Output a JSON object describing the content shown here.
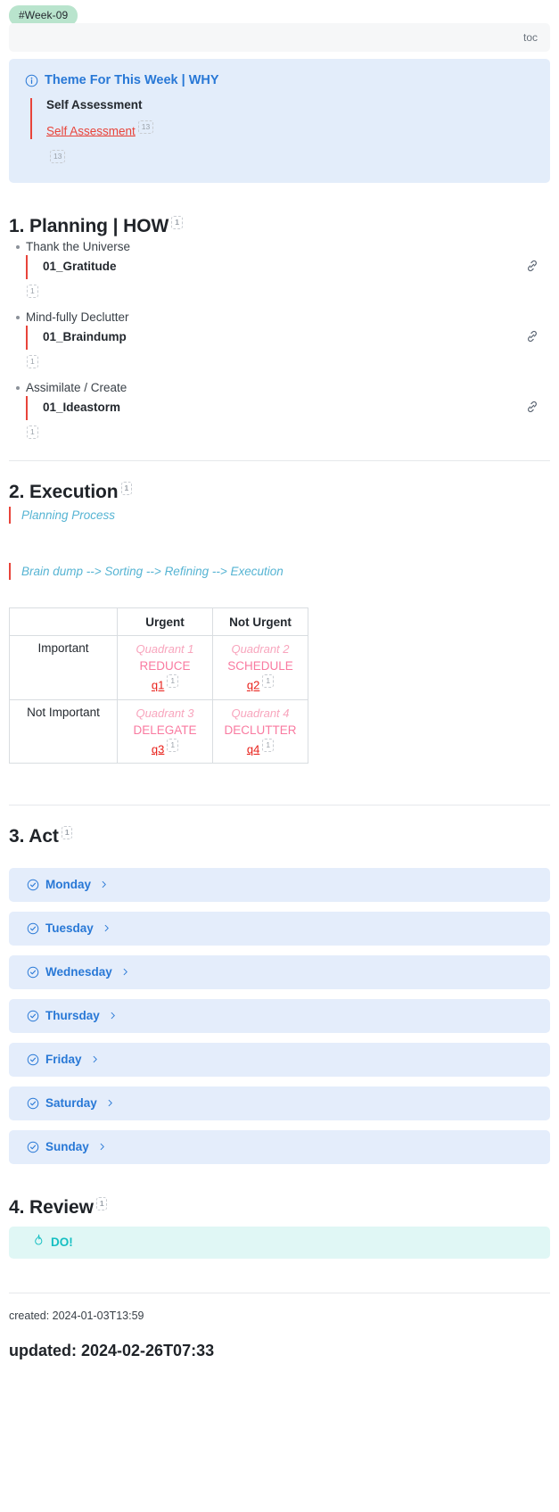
{
  "tag": "#Week-09",
  "toc": {
    "label": "toc"
  },
  "callout": {
    "icon": "info-circle-icon",
    "title": "Theme For This Week | WHY",
    "quote_heading": "Self Assessment",
    "quote_link": "Self Assessment",
    "quote_link_badge": "13",
    "tail_badge": "13"
  },
  "sections": {
    "planning": {
      "heading": "1. Planning | HOW",
      "heading_badge": "1",
      "items": [
        {
          "bullet": "Thank the Universe",
          "title": "01_Gratitude",
          "badge": "1",
          "link_icon": "link-icon"
        },
        {
          "bullet": "Mind-fully Declutter",
          "title": "01_Braindump",
          "badge": "1",
          "link_icon": "link-icon"
        },
        {
          "bullet": "Assimilate / Create",
          "title": "01_Ideastorm",
          "badge": "1",
          "link_icon": "link-icon"
        }
      ]
    },
    "execution": {
      "heading": "2. Execution",
      "heading_badge": "1",
      "quote1": "Planning Process",
      "quote2": "Brain dump --> Sorting --> Refining --> Execution"
    },
    "act": {
      "heading": "3. Act",
      "heading_badge": "1",
      "days": [
        {
          "label": "Monday",
          "icon": "circle-check-icon",
          "chevron": "chevron-right-icon"
        },
        {
          "label": "Tuesday",
          "icon": "circle-check-icon",
          "chevron": "chevron-right-icon"
        },
        {
          "label": "Wednesday",
          "icon": "circle-check-icon",
          "chevron": "chevron-right-icon"
        },
        {
          "label": "Thursday",
          "icon": "circle-check-icon",
          "chevron": "chevron-right-icon"
        },
        {
          "label": "Friday",
          "icon": "circle-check-icon",
          "chevron": "chevron-right-icon"
        },
        {
          "label": "Saturday",
          "icon": "circle-check-icon",
          "chevron": "chevron-right-icon"
        },
        {
          "label": "Sunday",
          "icon": "circle-check-icon",
          "chevron": "chevron-right-icon"
        }
      ]
    },
    "review": {
      "heading": "4. Review",
      "heading_badge": "1",
      "do": {
        "icon": "flame-icon",
        "label": "DO!"
      }
    }
  },
  "matrix": {
    "corner": "",
    "columns": [
      "Urgent",
      "Not Urgent"
    ],
    "rows": [
      {
        "label": "Important",
        "cells": [
          {
            "name": "Quadrant 1",
            "action": "REDUCE",
            "link": "q1",
            "badge": "1"
          },
          {
            "name": "Quadrant 2",
            "action": "SCHEDULE",
            "link": "q2",
            "badge": "1"
          }
        ]
      },
      {
        "label": "Not Important",
        "cells": [
          {
            "name": "Quadrant 3",
            "action": "DELEGATE",
            "link": "q3",
            "badge": "1"
          },
          {
            "name": "Quadrant 4",
            "action": "DECLUTTER",
            "link": "q4",
            "badge": "1"
          }
        ]
      }
    ]
  },
  "footer": {
    "created": "created: 2024-01-03T13:59",
    "updated": "updated: 2024-02-26T07:33"
  },
  "colors": {
    "tag_bg": "#b9e4cd",
    "callout_bg": "#e3edfa",
    "accent_blue": "#2878d6",
    "quote_red": "#e8443a",
    "pink": "#f97aa0",
    "pink_light": "#f8a5bd",
    "teal": "#16bfc2",
    "cyan_italic": "#56b4d3",
    "day_bg": "#e4edfb",
    "do_bg": "#e0f7f5"
  }
}
